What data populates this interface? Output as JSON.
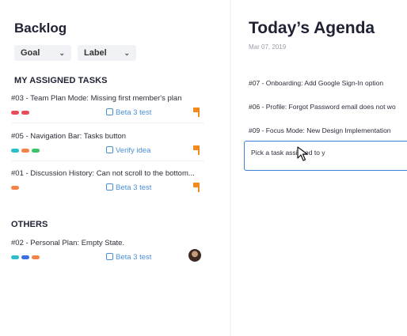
{
  "backlog": {
    "title": "Backlog",
    "filters": [
      {
        "label": "Goal"
      },
      {
        "label": "Label"
      }
    ],
    "sections": {
      "mine": "MY ASSIGNED TASKS",
      "others": "OTHERS"
    },
    "my_tasks": [
      {
        "title": "#03 - Team Plan Mode: Missing first member's plan",
        "labels": [
          "#e84c5a",
          "#e84c5a"
        ],
        "goal": "Beta 3 test",
        "priority": "flag"
      },
      {
        "title": "#05 - Navigation Bar: Tasks button",
        "labels": [
          "#2bbdc8",
          "#f2844a",
          "#3bc26b"
        ],
        "goal": "Verify idea",
        "priority": "flag"
      },
      {
        "title": "#01 - Discussion History: Can not scroll to the bottom...",
        "labels": [
          "#f2844a"
        ],
        "goal": "Beta 3 test",
        "priority": "flag"
      }
    ],
    "other_tasks": [
      {
        "title": "#02 - Personal Plan: Empty State.",
        "labels": [
          "#2bbdc8",
          "#3b6fe0",
          "#f2844a"
        ],
        "goal": "Beta 3 test",
        "assignee": "avatar"
      }
    ]
  },
  "agenda": {
    "title": "Today’s Agenda",
    "date": "Mar 07, 2019",
    "items": [
      "#07 - Onboarding: Add Google Sign-In option",
      "#06 - Profile: Forgot Password email does not wo",
      "#09 - Focus Mode: New Design Implementation"
    ],
    "input_value": "Pick a task assigned to y"
  },
  "colors": {
    "accent": "#3d7fd6",
    "priority": "#f28b1e"
  }
}
